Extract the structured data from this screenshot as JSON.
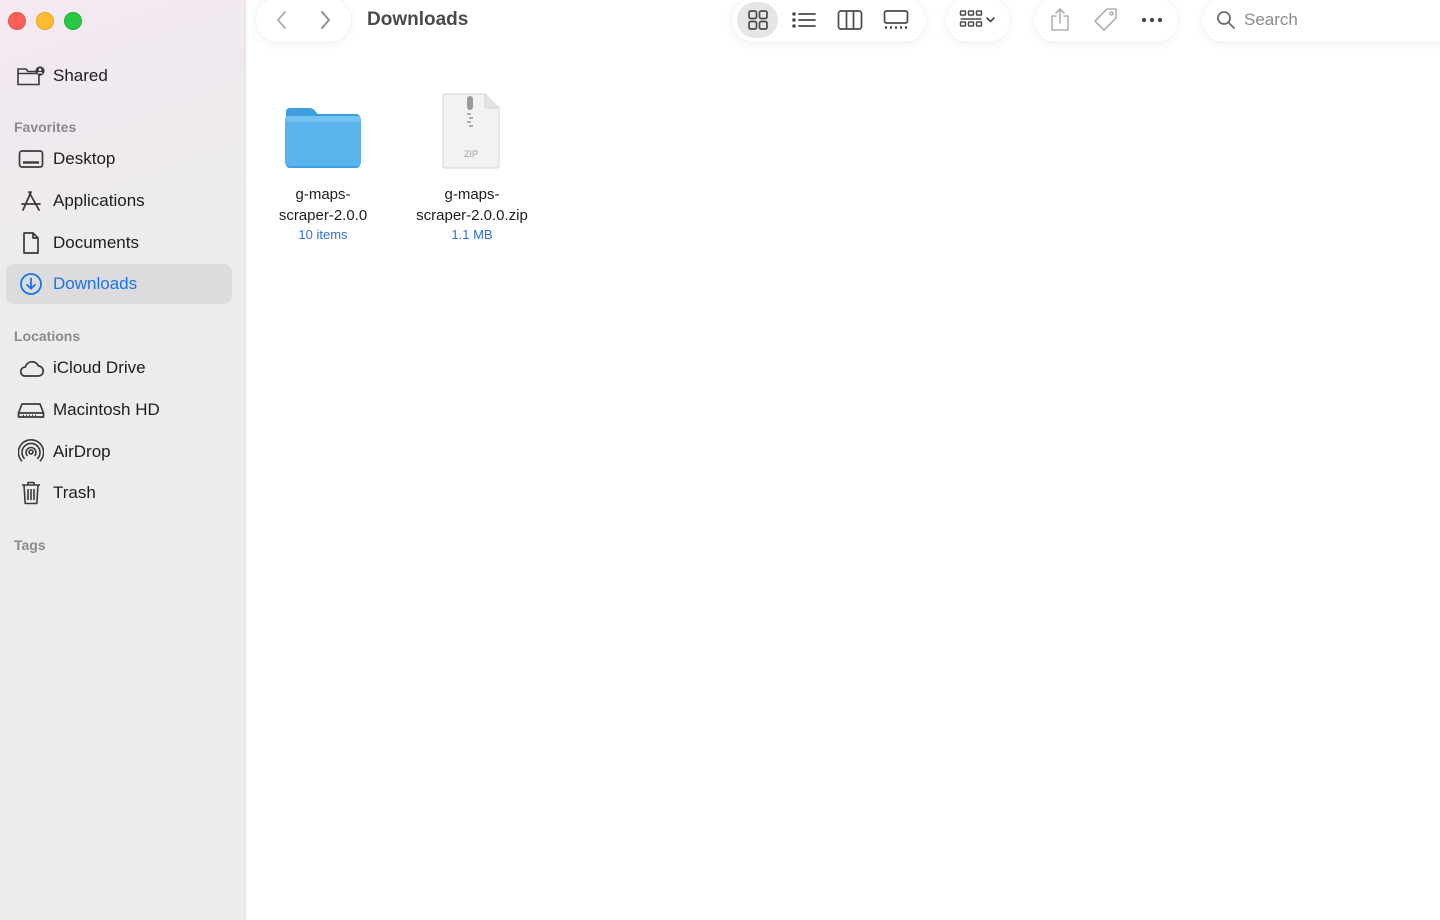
{
  "window": {
    "title": "Downloads",
    "traffic_lights": {
      "close": "#ff5f57",
      "minimize": "#febc2e",
      "maximize": "#28c840"
    }
  },
  "sidebar": {
    "shared": {
      "label": "Shared",
      "icon": "shared-folder-icon"
    },
    "favorites_header": "Favorites",
    "favorites": [
      {
        "label": "Desktop",
        "icon": "desktop-icon"
      },
      {
        "label": "Applications",
        "icon": "applications-icon"
      },
      {
        "label": "Documents",
        "icon": "document-icon"
      },
      {
        "label": "Downloads",
        "icon": "download-icon",
        "selected": true
      }
    ],
    "locations_header": "Locations",
    "locations": [
      {
        "label": "iCloud Drive",
        "icon": "cloud-icon"
      },
      {
        "label": "Macintosh HD",
        "icon": "hard-drive-icon"
      },
      {
        "label": "AirDrop",
        "icon": "airdrop-icon"
      },
      {
        "label": "Trash",
        "icon": "trash-icon"
      }
    ],
    "tags_header": "Tags"
  },
  "toolbar": {
    "view_modes": [
      {
        "name": "icon-view",
        "active": true
      },
      {
        "name": "list-view",
        "active": false
      },
      {
        "name": "column-view",
        "active": false
      },
      {
        "name": "gallery-view",
        "active": false
      }
    ],
    "search_placeholder": "Search"
  },
  "files": [
    {
      "name": "g-maps-scraper-2.0.0",
      "name_line1": "g-maps-",
      "name_line2": "scraper-2.0.0",
      "meta": "10 items",
      "kind": "folder"
    },
    {
      "name": "g-maps-scraper-2.0.0.zip",
      "name_line1": "g-maps-",
      "name_line2": "scraper-2.0.0.zip",
      "meta": "1.1 MB",
      "kind": "zip",
      "badge": "ZIP"
    }
  ],
  "colors": {
    "accent": "#1a73e8",
    "folder": "#5ab4ec",
    "selection": "#dcdcdf",
    "meta_text": "#2f6fd6"
  }
}
